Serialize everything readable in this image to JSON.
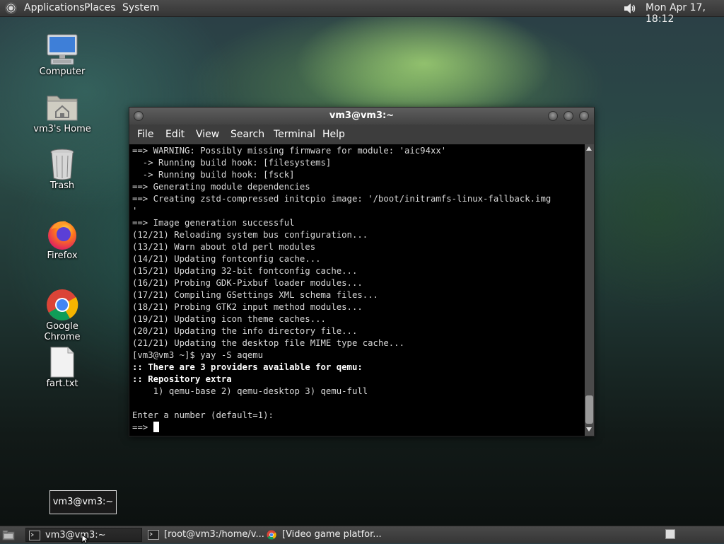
{
  "top_panel": {
    "menus": [
      "Applications",
      "Places",
      "System"
    ],
    "clock": "Mon Apr 17, 18:12"
  },
  "desktop_icons": [
    {
      "label": "Computer",
      "icon": "computer-icon"
    },
    {
      "label": "vm3's Home",
      "icon": "home-folder-icon"
    },
    {
      "label": "Trash",
      "icon": "trash-icon"
    },
    {
      "label": "Firefox",
      "icon": "firefox-icon"
    },
    {
      "label": "Google Chrome",
      "icon": "chrome-icon"
    },
    {
      "label": "fart.txt",
      "icon": "text-file-icon"
    }
  ],
  "terminal": {
    "title": "vm3@vm3:~",
    "menus": [
      "File",
      "Edit",
      "View",
      "Search",
      "Terminal",
      "Help"
    ],
    "lines": [
      {
        "text": "==> WARNING: Possibly missing firmware for module: 'aic94xx'",
        "bold": false
      },
      {
        "text": "  -> Running build hook: [filesystems]",
        "bold": false
      },
      {
        "text": "  -> Running build hook: [fsck]",
        "bold": false
      },
      {
        "text": "==> Generating module dependencies",
        "bold": false
      },
      {
        "text": "==> Creating zstd-compressed initcpio image: '/boot/initramfs-linux-fallback.img",
        "bold": false
      },
      {
        "text": "'",
        "bold": false
      },
      {
        "text": "==> Image generation successful",
        "bold": false
      },
      {
        "text": "(12/21) Reloading system bus configuration...",
        "bold": false
      },
      {
        "text": "(13/21) Warn about old perl modules",
        "bold": false
      },
      {
        "text": "(14/21) Updating fontconfig cache...",
        "bold": false
      },
      {
        "text": "(15/21) Updating 32-bit fontconfig cache...",
        "bold": false
      },
      {
        "text": "(16/21) Probing GDK-Pixbuf loader modules...",
        "bold": false
      },
      {
        "text": "(17/21) Compiling GSettings XML schema files...",
        "bold": false
      },
      {
        "text": "(18/21) Probing GTK2 input method modules...",
        "bold": false
      },
      {
        "text": "(19/21) Updating icon theme caches...",
        "bold": false
      },
      {
        "text": "(20/21) Updating the info directory file...",
        "bold": false
      },
      {
        "text": "(21/21) Updating the desktop file MIME type cache...",
        "bold": false
      },
      {
        "text": "[vm3@vm3 ~]$ yay -S aqemu",
        "bold": false
      },
      {
        "text": ":: There are 3 providers available for qemu:",
        "bold": true
      },
      {
        "text": ":: Repository extra",
        "bold": true
      },
      {
        "text": "    1) qemu-base 2) qemu-desktop 3) qemu-full",
        "bold": false
      },
      {
        "text": "",
        "bold": false
      },
      {
        "text": "Enter a number (default=1):",
        "bold": false
      }
    ],
    "prompt": "==> "
  },
  "tooltip": "vm3@vm3:~",
  "taskbar": {
    "tasks": [
      {
        "label": "vm3@vm3:~",
        "icon": "terminal-icon"
      },
      {
        "label": "[root@vm3:/home/v...",
        "icon": "terminal-icon"
      },
      {
        "label": "[Video game platfor...",
        "icon": "chrome-icon"
      }
    ]
  }
}
